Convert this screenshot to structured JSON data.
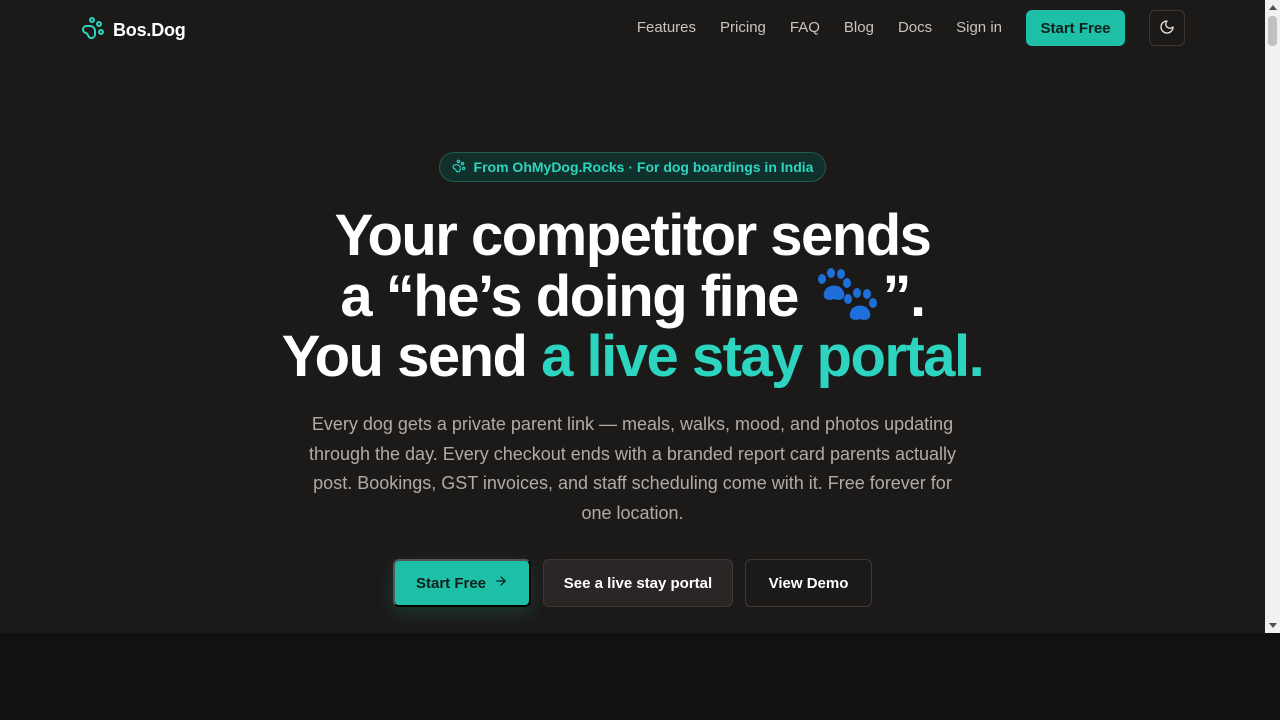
{
  "brand": {
    "name": "Bos.Dog",
    "logo_icon": "paw-icon"
  },
  "nav": {
    "links": [
      "Features",
      "Pricing",
      "FAQ",
      "Blog",
      "Docs",
      "Sign in"
    ],
    "cta_label": "Start Free",
    "theme_icon": "moon-icon"
  },
  "hero": {
    "badge_text": "From OhMyDog.Rocks · For dog boardings in India",
    "headline_line1": "Your competitor sends",
    "headline_line2_pre": "a “he’s doing fine ",
    "headline_line2_post": "”.",
    "headline_line3_pre": "You send ",
    "headline_line3_accent": "a live stay portal.",
    "subtitle": "Every dog gets a private parent link — meals, walks, mood, and photos updating through the day. Every checkout ends with a branded report card parents actually post. Bookings, GST invoices, and staff scheduling come with it. Free forever for one location.",
    "buttons": {
      "primary": "Start Free",
      "secondary": "See a live stay portal",
      "tertiary": "View Demo"
    }
  },
  "colors": {
    "accent": "#2dd4bf",
    "button": "#1dbfa7",
    "background": "#1c1a19"
  }
}
